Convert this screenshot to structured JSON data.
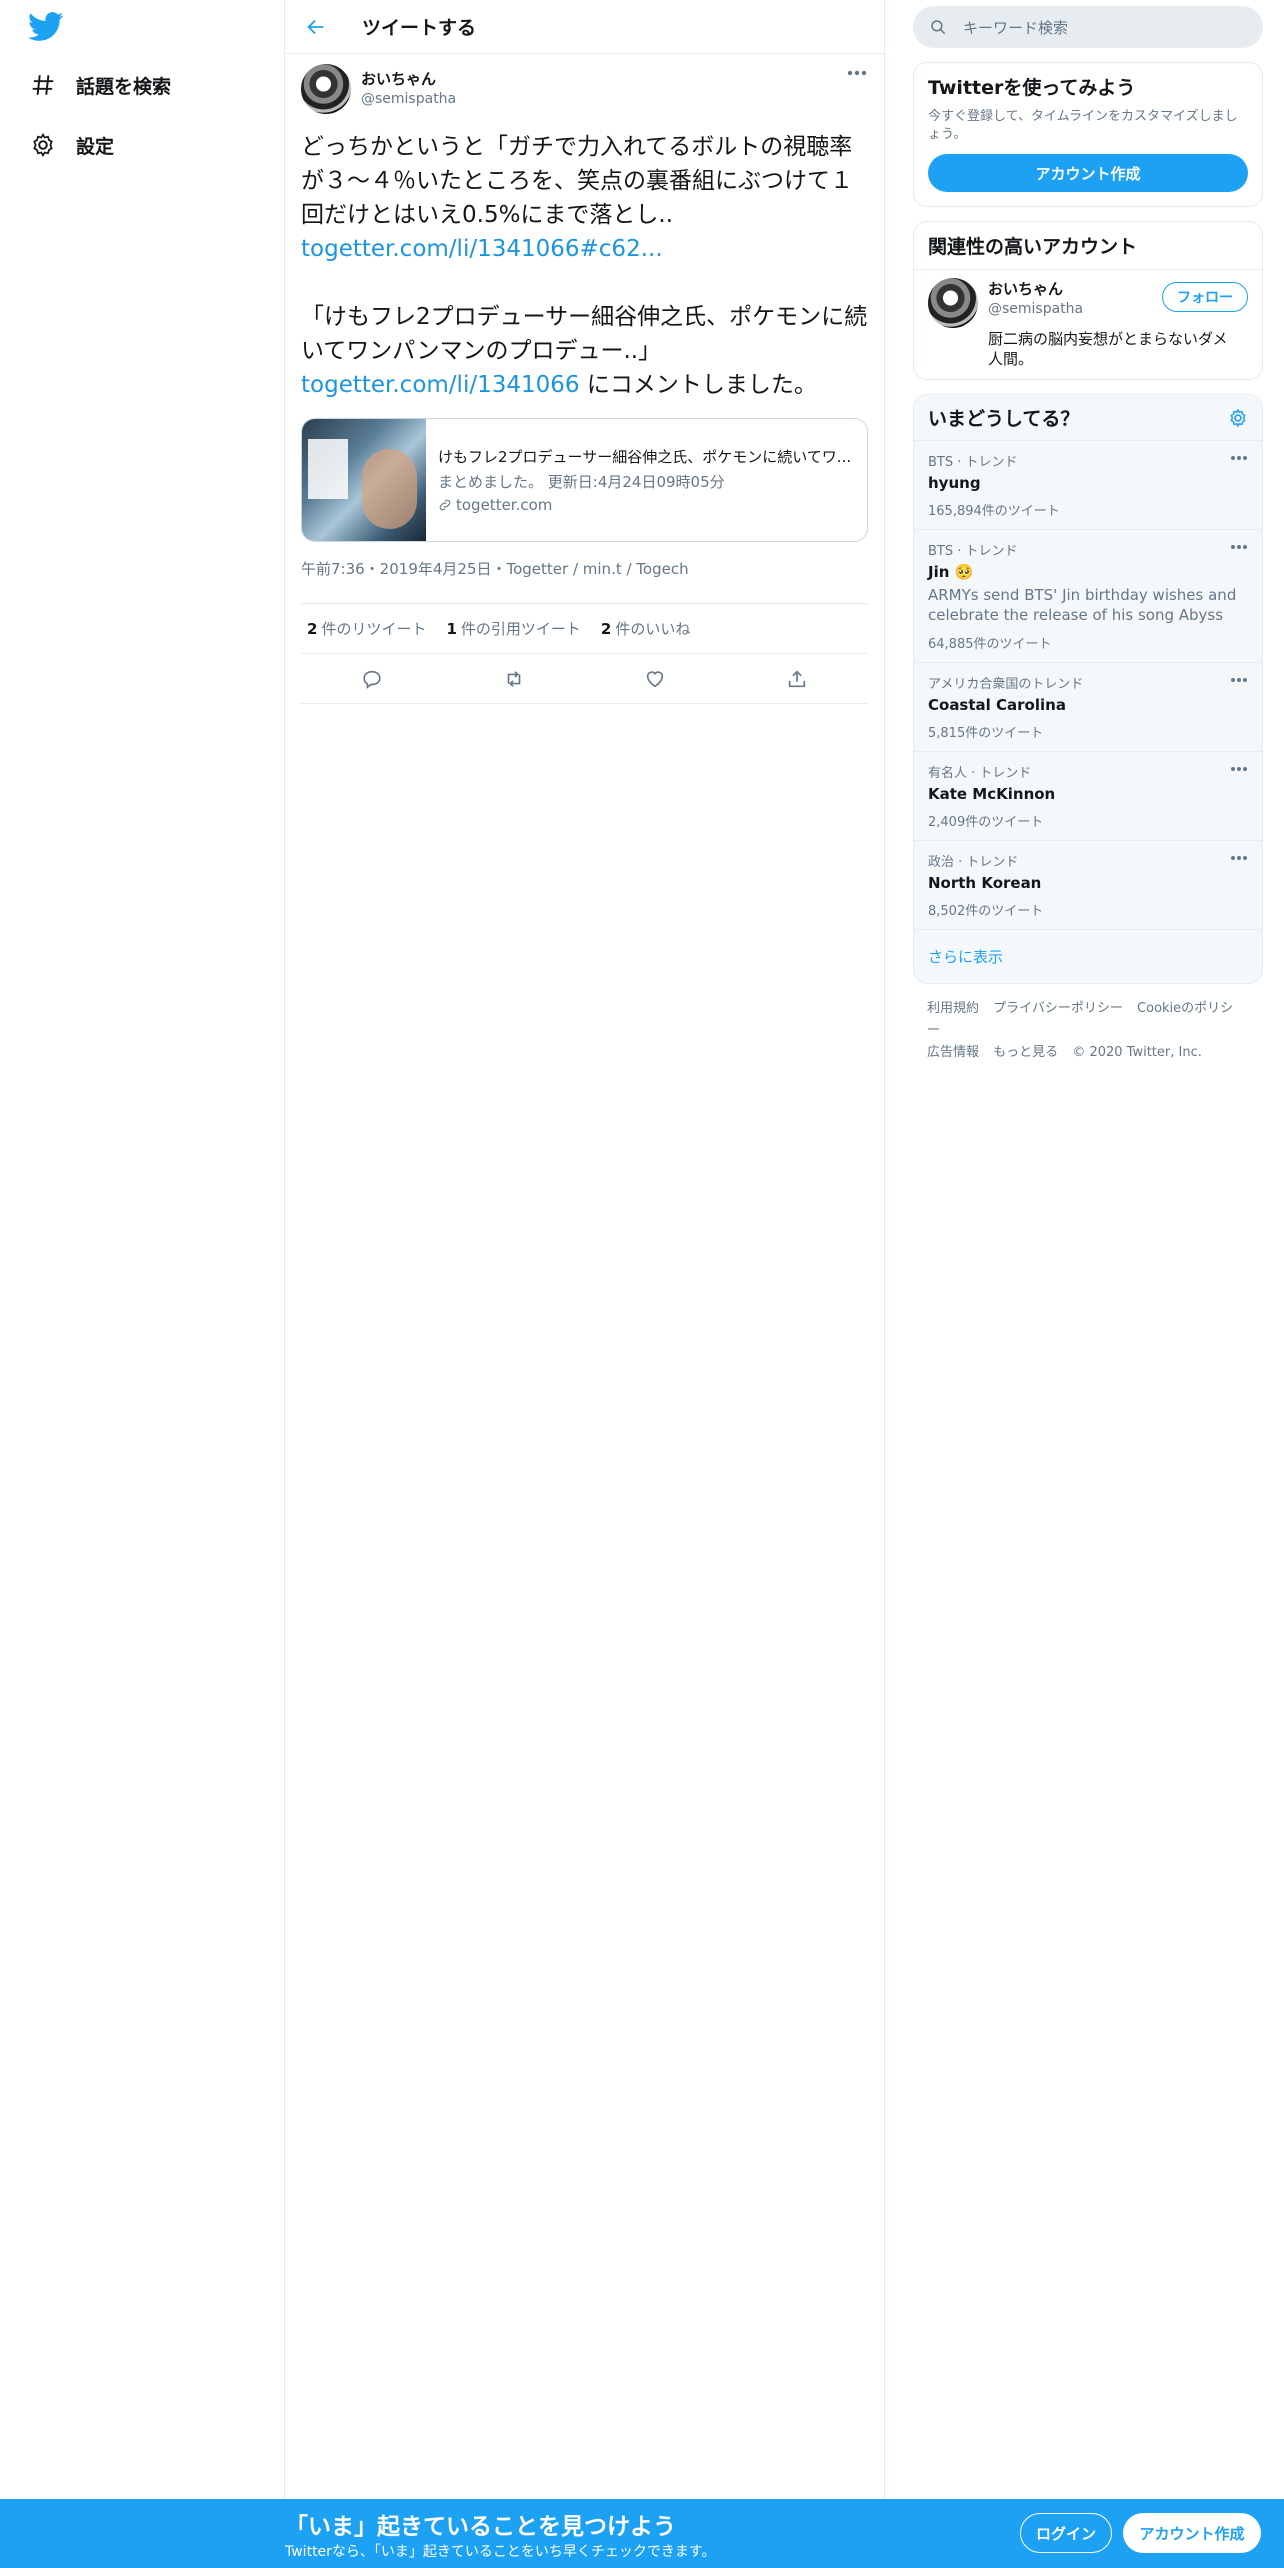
{
  "nav": {
    "explore_label": "話題を検索",
    "settings_label": "設定"
  },
  "header": {
    "title": "ツイートする"
  },
  "tweet": {
    "author_name": "おいちゃん",
    "author_handle": "@semispatha",
    "text_part1": "どっちかというと「ガチで力入れてるボルトの視聴率が３～４％いたところを、笑点の裏番組にぶつけて１回だけとはいえ0.5%にまで落とし..",
    "link1": "togetter.com/li/1341066#c62...",
    "text_part2": "「けもフレ2プロデューサー細谷伸之氏、ポケモンに続いてワンパンマンのプロデュー..」",
    "link2": "togetter.com/li/1341066",
    "text_part3": " にコメントしました。",
    "card_title": "けもフレ2プロデューサー細谷伸之氏、ポケモンに続いてワ...",
    "card_desc": "まとめました。 更新日:4月24日09時05分",
    "card_domain": "togetter.com",
    "meta": "午前7:36・2019年4月25日・Togetter / min.t / Togech",
    "retweets_count": "2",
    "retweets_label": "件のリツイート",
    "quotes_count": "1",
    "quotes_label": "件の引用ツイート",
    "likes_count": "2",
    "likes_label": "件のいいね"
  },
  "search": {
    "placeholder": "キーワード検索"
  },
  "signup_panel": {
    "title": "Twitterを使ってみよう",
    "subtitle": "今すぐ登録して、タイムラインをカスタマイズしましょう。",
    "button": "アカウント作成"
  },
  "related": {
    "title": "関連性の高いアカウント",
    "name": "おいちゃん",
    "handle": "@semispatha",
    "bio": "厨二病の脳内妄想がとまらないダメ人間。",
    "follow_label": "フォロー"
  },
  "trends": {
    "title": "いまどうしてる？",
    "items": [
      {
        "context": "BTS · トレンド",
        "name": "hyung",
        "desc": "",
        "count": "165,894件のツイート"
      },
      {
        "context": "BTS · トレンド",
        "name": "Jin 🥺",
        "desc": "ARMYs send BTS' Jin birthday wishes and celebrate the release of his song Abyss",
        "count": "64,885件のツイート"
      },
      {
        "context": "アメリカ合衆国のトレンド",
        "name": "Coastal Carolina",
        "desc": "",
        "count": "5,815件のツイート"
      },
      {
        "context": "有名人 · トレンド",
        "name": "Kate McKinnon",
        "desc": "",
        "count": "2,409件のツイート"
      },
      {
        "context": "政治 · トレンド",
        "name": "North Korean",
        "desc": "",
        "count": "8,502件のツイート"
      }
    ],
    "show_more": "さらに表示"
  },
  "footer": {
    "terms": "利用規約",
    "privacy": "プライバシーポリシー",
    "cookie": "Cookieのポリシー",
    "ads": "広告情報",
    "more": "もっと見る",
    "copyright": "© 2020 Twitter, Inc."
  },
  "bottombar": {
    "title": "「いま」起きていることを見つけよう",
    "subtitle": "Twitterなら、「いま」起きていることをいち早くチェックできます。",
    "login": "ログイン",
    "signup": "アカウント作成"
  },
  "colors": {
    "accent": "#1da1f2",
    "secondary_text": "#657786",
    "border": "#e6ecf0"
  }
}
